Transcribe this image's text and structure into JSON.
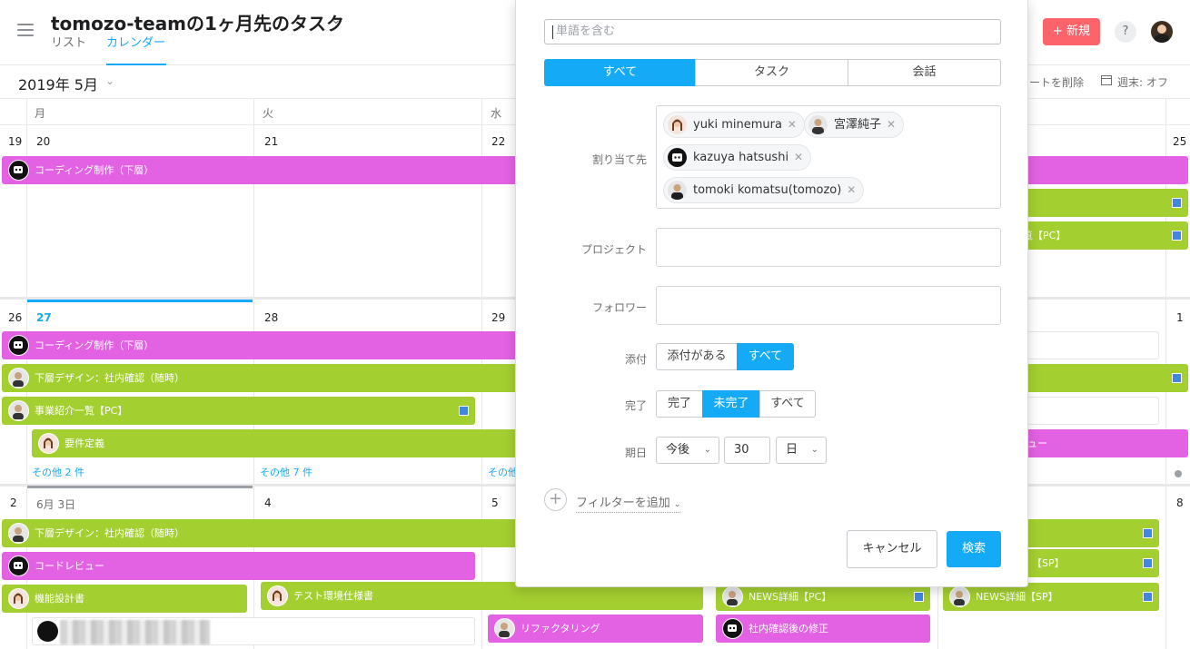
{
  "header": {
    "title": "tomozo-teamの1ヶ月先のタスク",
    "tabs": [
      "リスト",
      "カレンダー"
    ],
    "new_button": "新規",
    "help": "?"
  },
  "toolbar": {
    "month": "2019年 5月",
    "delete_fragment": "ートを削除",
    "weekend": "週末: オフ"
  },
  "calendar": {
    "weekdays": [
      "月",
      "火",
      "水"
    ],
    "week1": {
      "days": [
        "19",
        "20",
        "21",
        "22",
        "25"
      ]
    },
    "week2": {
      "days": [
        "26",
        "27",
        "28",
        "29",
        "1"
      ],
      "more": [
        "その他 2 件",
        "その他 7 件",
        "その他"
      ]
    },
    "week3": {
      "days": [
        "2",
        "6月 3日",
        "4",
        "5",
        "8"
      ]
    },
    "tasks": {
      "coding": "コーディング制作（下層）",
      "frag_ran": "覧【PC】",
      "lower_design": "下層デザイン：社内確認（随時）",
      "business_list": "事業紹介一覧【PC】",
      "requirements": "要件定義",
      "frag_view": "ュー",
      "code_review": "コードレビュー",
      "func_design": "機能設計書",
      "test_env": "テスト環境仕様書",
      "news_pc": "NEWS詳細【PC】",
      "news_sp": "NEWS詳細【SP】",
      "frag_sp": "【SP】",
      "refactoring": "リファクタリング",
      "internal_fix": "社内確認後の修正"
    }
  },
  "search_panel": {
    "placeholder": "単語を含む",
    "type_segments": [
      "すべて",
      "タスク",
      "会話"
    ],
    "assignee_label": "割り当て先",
    "assignees": [
      "yuki minemura",
      "宮澤純子",
      "kazuya hatsushi",
      "tomoki komatsu(tomozo)"
    ],
    "project_label": "プロジェクト",
    "follower_label": "フォロワー",
    "attachment_label": "添付",
    "attachment_options": [
      "添付がある",
      "すべて"
    ],
    "completion_label": "完了",
    "completion_options": [
      "完了",
      "未完了",
      "すべて"
    ],
    "due_label": "期日",
    "due_when": "今後",
    "due_amount": "30",
    "due_unit": "日",
    "add_filter": "フィルターを追加",
    "cancel": "キャンセル",
    "search": "検索"
  }
}
